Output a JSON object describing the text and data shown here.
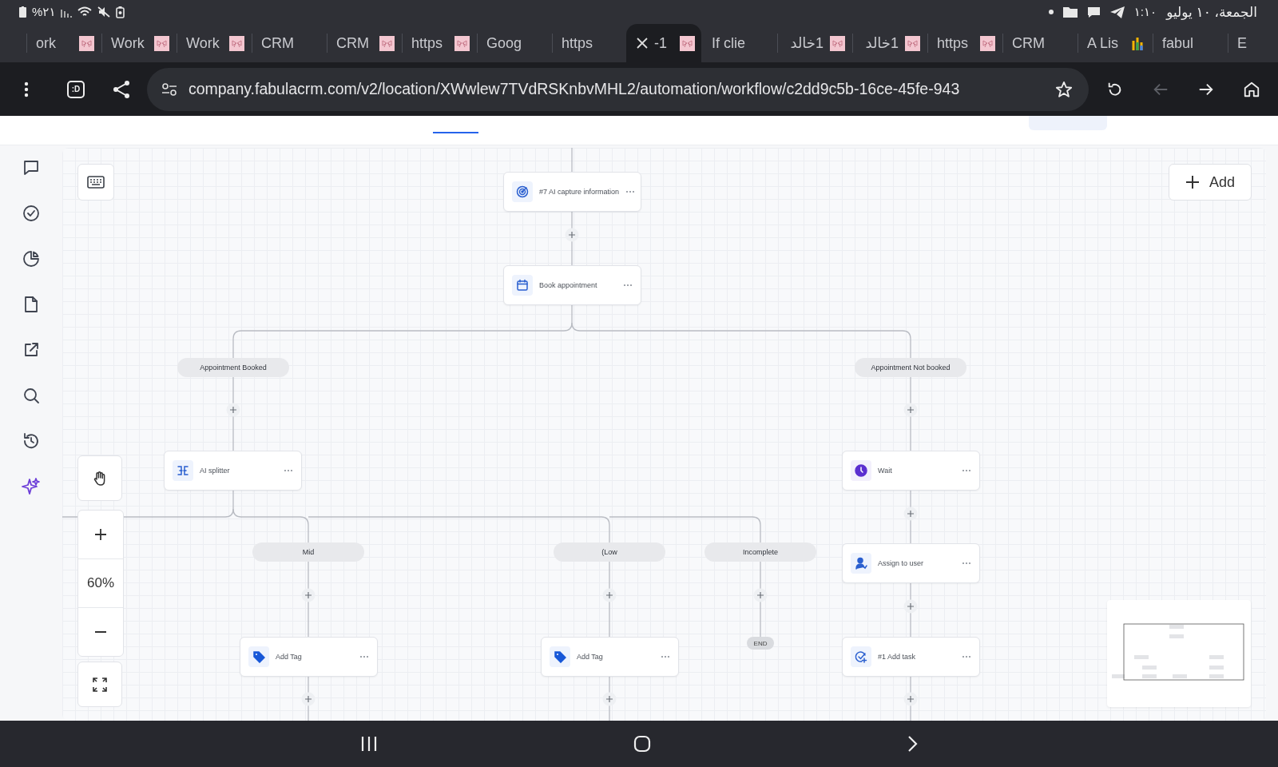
{
  "status_bar": {
    "battery": "%٢١",
    "time": "١:١٠",
    "date": "الجمعة، ١٠ يوليو"
  },
  "tabs": [
    {
      "label": "ork",
      "selected": false
    },
    {
      "label": "Work",
      "selected": false
    },
    {
      "label": "Work",
      "selected": false
    },
    {
      "label": "CRM",
      "selected": false
    },
    {
      "label": "CRM",
      "selected": false
    },
    {
      "label": "https",
      "selected": false
    },
    {
      "label": "Goog",
      "selected": false
    },
    {
      "label": "https",
      "selected": false
    },
    {
      "label": "-1",
      "selected": true
    },
    {
      "label": "If clie",
      "selected": false
    },
    {
      "label": "1خالد",
      "selected": false
    },
    {
      "label": "1خالد",
      "selected": false
    },
    {
      "label": "https",
      "selected": false
    },
    {
      "label": "CRM",
      "selected": false
    },
    {
      "label": "A Lis",
      "selected": false
    },
    {
      "label": "fabul",
      "selected": false
    },
    {
      "label": "E",
      "selected": false
    }
  ],
  "toolbar": {
    "tab_switcher": ":D",
    "url": "company.fabulacrm.com/v2/location/XWwlew7TVdRSKnbvMHL2/automation/workflow/c2dd9c5b-16ce-45fe-943",
    "back_disabled": true
  },
  "sidebar": {
    "items": [
      {
        "selected": false
      },
      {
        "selected": false
      },
      {
        "selected": false
      },
      {
        "selected": false
      },
      {
        "selected": false
      },
      {
        "selected": false
      },
      {
        "selected": false
      },
      {
        "selected": true
      }
    ]
  },
  "workflow": {
    "add_button": "Add",
    "nodes": [
      {
        "title": "#7 AI capture information"
      },
      {
        "title": "Book appointment"
      },
      {
        "title": "AI splitter"
      },
      {
        "title": "Wait"
      },
      {
        "title": "Assign to user"
      },
      {
        "title": "Add Tag"
      },
      {
        "title": "Add Tag"
      },
      {
        "title": "#1 Add task"
      }
    ],
    "branches": [
      {
        "label": "Appointment Booked"
      },
      {
        "label": "Appointment Not booked"
      },
      {
        "label": "Mid"
      },
      {
        "label": "(Low"
      },
      {
        "label": "Incomplete"
      }
    ],
    "end_label": "END",
    "zoom": "60%"
  }
}
